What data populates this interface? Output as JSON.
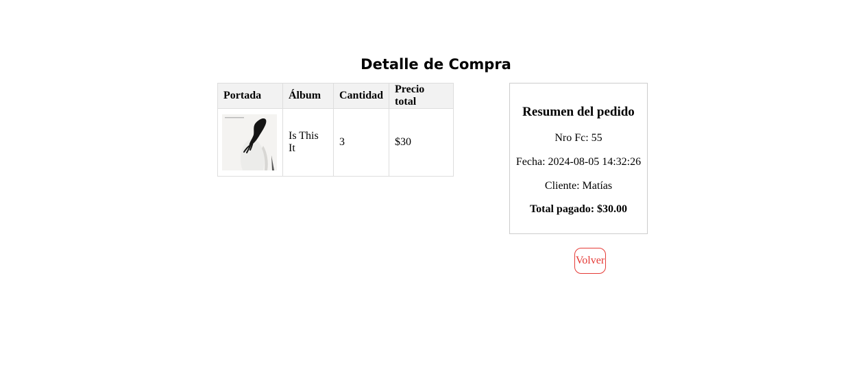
{
  "page": {
    "title": "Detalle de Compra"
  },
  "table": {
    "headers": [
      "Portada",
      "Álbum",
      "Cantidad",
      "Precio total"
    ],
    "rows": [
      {
        "album": "Is This It",
        "cantidad": "3",
        "precio_total": "$30"
      }
    ]
  },
  "summary": {
    "title": "Resumen del pedido",
    "nro_fc": "Nro Fc: 55",
    "fecha": "Fecha: 2024-08-05 14:32:26",
    "cliente": "Cliente: Matías",
    "total": "Total pagado: $30.00"
  },
  "actions": {
    "back_label": "Volver"
  },
  "colors": {
    "accent": "#e53935",
    "header_bg": "#f2f2f2",
    "border": "#dddddd"
  }
}
